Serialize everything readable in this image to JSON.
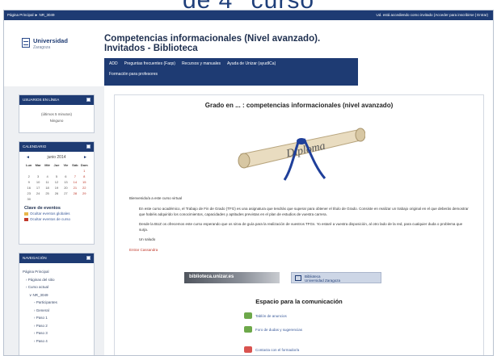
{
  "slide_title_fragment": "de 4° curso",
  "topbar": {
    "breadcrumb": "Página Principal ► NR_3049",
    "login_status": "Ud. está accediendo como invitado (Acceder para inscribirse | Entrar)"
  },
  "brand": {
    "name": "Universidad",
    "sub": "Zaragoza"
  },
  "course_title_line1": "Competencias informacionales (Nivel avanzado).",
  "course_title_line2": "Invitados - Biblioteca",
  "nav_menu": [
    "ADD",
    "Preguntas frecuentes (Faqs)",
    "Recursos y manuales",
    "Ayuda de Unizar (ayudICa)",
    "Formación para profesores"
  ],
  "blocks": {
    "users": {
      "title": "USUARIOS EN LÍNEA",
      "lines": [
        "(últimos 5 minutos)",
        "Ninguno"
      ]
    },
    "calendar": {
      "title": "CALENDARIO",
      "month": "junio 2014",
      "prev": "◄",
      "next": "►",
      "days": [
        "Lun",
        "Mar",
        "Mié",
        "Jue",
        "Vie",
        "Sáb",
        "Dom"
      ],
      "dates": [
        "",
        "",
        "",
        "",
        "",
        "",
        "1",
        "2",
        "3",
        "4",
        "5",
        "6",
        "7",
        "8",
        "9",
        "10",
        "11",
        "12",
        "13",
        "14",
        "15",
        "16",
        "17",
        "18",
        "19",
        "20",
        "21",
        "22",
        "23",
        "24",
        "25",
        "26",
        "27",
        "28",
        "29",
        "30",
        "",
        "",
        "",
        "",
        "",
        ""
      ],
      "key_title": "Clave de eventos",
      "key_items": [
        {
          "label": "Ocultar eventos globales",
          "color": "#e8b74a"
        },
        {
          "label": "Ocultar eventos de curso",
          "color": "#c0392b"
        }
      ]
    },
    "navigation": {
      "title": "NAVEGACIÓN",
      "items": [
        "Página Principal",
        "› Páginas del sitio",
        "› Curso actual",
        "∨ NR_3049",
        "◦ Participantes",
        "› General",
        "› Paso 1",
        "› Paso 2",
        "› Paso 3",
        "› Paso 4"
      ]
    }
  },
  "main": {
    "heading": "Grado en ... : competencias informacionales (nivel avanzado)",
    "diploma_text": "Diploma",
    "welcome": "Bienvenido/a a este curso virtual",
    "paragraphs": [
      "En este curso académico, el Trabajo de Fin de Grado (TFG) es una asignatura que tendrás que superar para obtener el título de Grado. Consiste en realizar un trabajo original en el que deberás demostrar que habéis adquirido los conocimientos, capacidades y aptitudes previstas en el plan de estudios de vuestra carrera.",
      "Desde la BUZ os ofrecemos este curso esperando que os sirva de guía para la realización de vuestros TFGs. Yo estaré a vuestra disposición, al otro lado de la red, para cualquier duda o problema que surja.",
      "Un saludo"
    ],
    "enter_link": "Entrar Cassandra",
    "banner_left": "biblioteca.unizar.es",
    "banner_right_line1": "Biblioteca",
    "banner_right_line2": "Universidad Zaragoza",
    "section_title": "Espacio para la comunicación",
    "activities": [
      {
        "label": "Tablón de anuncios",
        "color": "#6da84a"
      },
      {
        "label": "Foro de dudas y sugerencias",
        "color": "#6da84a"
      },
      {
        "label": "Contacta con el formador/a",
        "color": "#d9534f"
      }
    ]
  }
}
